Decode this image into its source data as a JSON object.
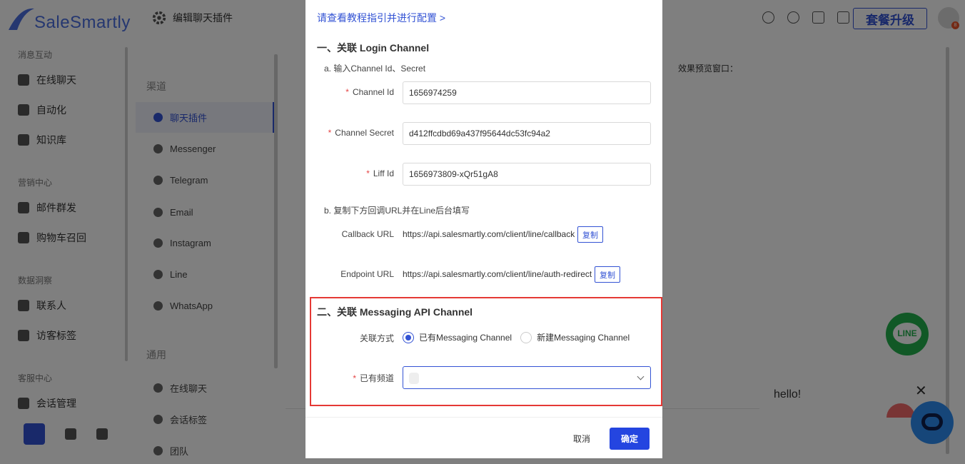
{
  "brand": {
    "logo_text": "SaleSmartly"
  },
  "header": {
    "page_title": "编辑聊天插件",
    "upgrade_label": "套餐升级",
    "avatar_badge": "8",
    "icons": [
      "compass-icon",
      "pie-chart-icon",
      "copy-icon",
      "translate-icon"
    ]
  },
  "sidebar": {
    "groups": [
      {
        "title": "消息互动",
        "items": [
          "在线聊天",
          "自动化",
          "知识库"
        ]
      },
      {
        "title": "营销中心",
        "items": [
          "邮件群发",
          "购物车召回"
        ]
      },
      {
        "title": "数据洞察",
        "items": [
          "联系人",
          "访客标签"
        ]
      },
      {
        "title": "客服中心",
        "items": [
          "会话管理"
        ]
      }
    ]
  },
  "subnav": {
    "channel_title": "渠道",
    "channels": [
      "聊天插件",
      "Messenger",
      "Telegram",
      "Email",
      "Instagram",
      "Line",
      "WhatsApp"
    ],
    "general_title": "通用",
    "general": [
      "在线聊天",
      "会话标签",
      "团队"
    ]
  },
  "content": {
    "preview_label": "效果预览窗口："
  },
  "widget": {
    "hello_text": "hello!",
    "close_symbol": "✕",
    "line_label": "LINE"
  },
  "modal": {
    "tutorial_link": "请查看教程指引并进行配置 >",
    "section1_title": "一、关联 Login Channel",
    "step_a": "a. 输入Channel Id、Secret",
    "channel_id_label": "Channel Id",
    "channel_id_value": "1656974259",
    "channel_secret_label": "Channel Secret",
    "channel_secret_value": "d412ffcdbd69a437f95644dc53fc94a2",
    "liff_id_label": "Liff Id",
    "liff_id_value": "1656973809-xQr51gA8",
    "step_b": "b. 复制下方回调URL并在Line后台填写",
    "callback_label": "Callback URL",
    "callback_value": "https://api.salesmartly.com/client/line/callback",
    "endpoint_label": "Endpoint URL",
    "endpoint_value": "https://api.salesmartly.com/client/line/auth-redirect",
    "copy_label": "复制",
    "section2_title": "二、关联 Messaging API Channel",
    "link_method_label": "关联方式",
    "radio_existing": "已有Messaging Channel",
    "radio_new": "新建Messaging Channel",
    "existing_channel_label": "已有频道",
    "existing_channel_value": "",
    "cancel_label": "取消",
    "ok_label": "确定"
  }
}
